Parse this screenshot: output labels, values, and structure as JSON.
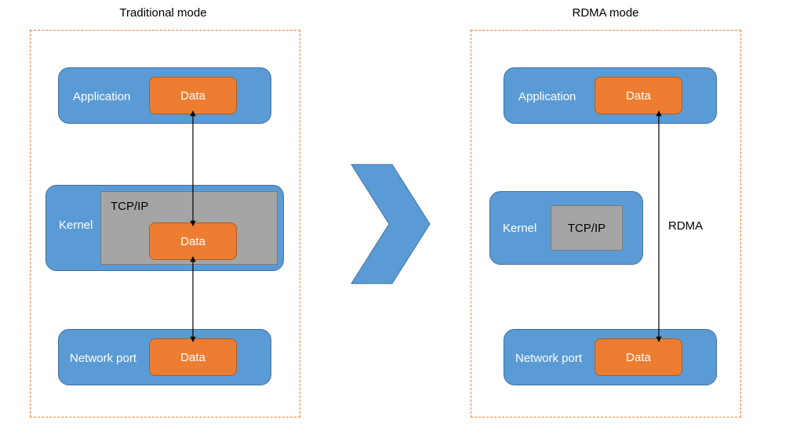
{
  "left": {
    "title": "Traditional mode",
    "application_label": "Application",
    "application_data": "Data",
    "kernel_label": "Kernel",
    "kernel_tcpip": "TCP/IP",
    "kernel_data": "Data",
    "network_label": "Network port",
    "network_data": "Data"
  },
  "right": {
    "title": "RDMA mode",
    "application_label": "Application",
    "application_data": "Data",
    "kernel_label": "Kernel",
    "kernel_tcpip": "TCP/IP",
    "network_label": "Network port",
    "network_data": "Data",
    "rdma_label": "RDMA"
  }
}
